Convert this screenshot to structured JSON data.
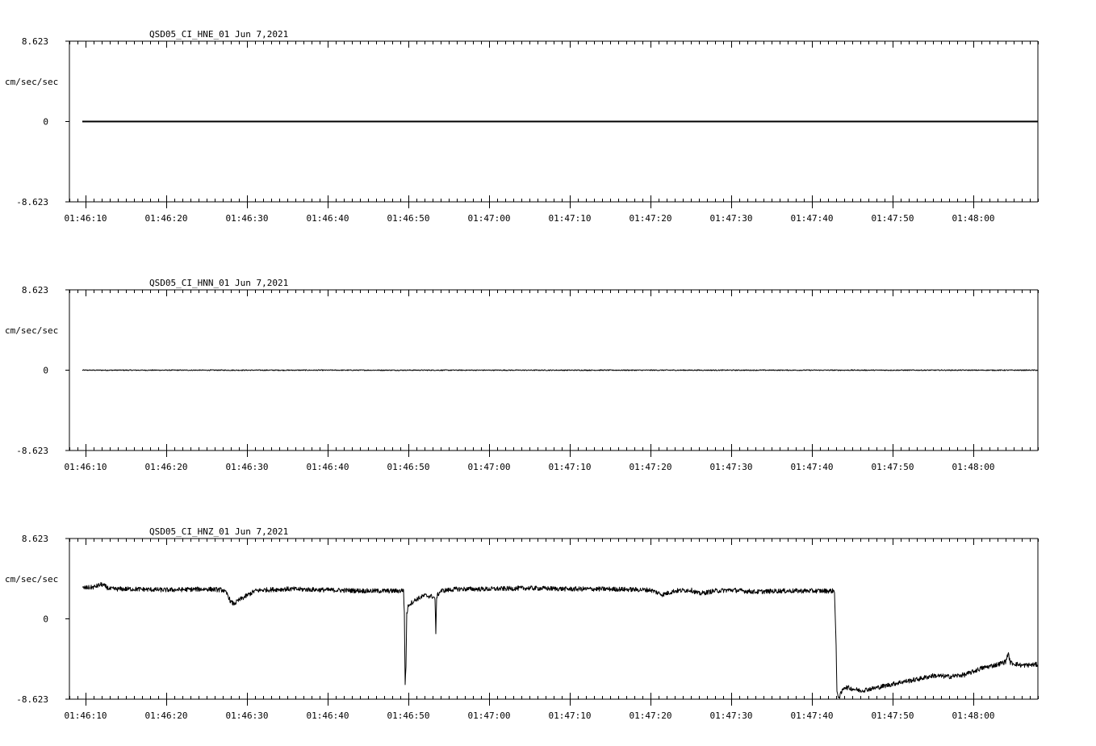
{
  "chart_data": [
    {
      "type": "line",
      "title": "QSD05_CI_HNE_01  Jun 7,2021",
      "ylabel": "cm/sec/sec",
      "ylim": [
        -8.623,
        8.623
      ],
      "y_ticks": [
        "8.623",
        "0",
        "-8.623"
      ],
      "x_ticks": [
        "01:46:10",
        "01:46:20",
        "01:46:30",
        "01:46:40",
        "01:46:50",
        "01:47:00",
        "01:47:10",
        "01:47:20",
        "01:47:30",
        "01:47:40",
        "01:47:50",
        "01:48:00"
      ],
      "x_range_seconds_after_014610": [
        -2.0,
        118.0
      ],
      "trace_start_seconds_after_014610": -0.4,
      "grid": false,
      "series": [
        {
          "values": [
            [
              -0.4,
              0
            ],
            [
              118.0,
              0
            ]
          ],
          "noise": 0
        }
      ]
    },
    {
      "type": "line",
      "title": "QSD05_CI_HNN_01  Jun 7,2021",
      "ylabel": "cm/sec/sec",
      "ylim": [
        -8.623,
        8.623
      ],
      "y_ticks": [
        "8.623",
        "0",
        "-8.623"
      ],
      "x_ticks": [
        "01:46:10",
        "01:46:20",
        "01:46:30",
        "01:46:40",
        "01:46:50",
        "01:47:00",
        "01:47:10",
        "01:47:20",
        "01:47:30",
        "01:47:40",
        "01:47:50",
        "01:48:00"
      ],
      "x_range_seconds_after_014610": [
        -2.0,
        118.0
      ],
      "trace_start_seconds_after_014610": -0.4,
      "grid": false,
      "series": [
        {
          "values": [
            [
              -0.4,
              0
            ],
            [
              118.0,
              0
            ]
          ],
          "noise": 0.05
        }
      ]
    },
    {
      "type": "line",
      "title": "QSD05_CI_HNZ_01  Jun 7,2021",
      "ylabel": "cm/sec/sec",
      "ylim": [
        -8.623,
        8.623
      ],
      "y_ticks": [
        "8.623",
        "0",
        "-8.623"
      ],
      "x_ticks": [
        "01:46:10",
        "01:46:20",
        "01:46:30",
        "01:46:40",
        "01:46:50",
        "01:47:00",
        "01:47:10",
        "01:47:20",
        "01:47:30",
        "01:47:40",
        "01:47:50",
        "01:48:00"
      ],
      "x_range_seconds_after_014610": [
        -2.0,
        118.0
      ],
      "trace_start_seconds_after_014610": -0.4,
      "grid": false,
      "series": [
        {
          "values": [
            [
              -0.4,
              3.3
            ],
            [
              1.0,
              3.4
            ],
            [
              2.0,
              3.7
            ],
            [
              3.0,
              3.2
            ],
            [
              6.0,
              3.2
            ],
            [
              10.0,
              3.1
            ],
            [
              15.0,
              3.2
            ],
            [
              17.0,
              3.1
            ],
            [
              17.6,
              2.6
            ],
            [
              18.0,
              1.8
            ],
            [
              18.4,
              1.6
            ],
            [
              19.0,
              2.0
            ],
            [
              20.0,
              2.5
            ],
            [
              21.0,
              3.0
            ],
            [
              22.0,
              3.1
            ],
            [
              25.0,
              3.2
            ],
            [
              30.0,
              3.1
            ],
            [
              35.0,
              3.0
            ],
            [
              39.0,
              3.0
            ],
            [
              39.4,
              3.1
            ],
            [
              39.5,
              0.5
            ],
            [
              39.6,
              -7.0
            ],
            [
              39.7,
              -5.0
            ],
            [
              39.8,
              0.5
            ],
            [
              40.0,
              1.5
            ],
            [
              41.0,
              2.1
            ],
            [
              42.0,
              2.5
            ],
            [
              43.0,
              2.4
            ],
            [
              43.3,
              2.2
            ],
            [
              43.4,
              -1.8
            ],
            [
              43.5,
              2.4
            ],
            [
              44.0,
              3.0
            ],
            [
              46.0,
              3.2
            ],
            [
              50.0,
              3.2
            ],
            [
              55.0,
              3.3
            ],
            [
              60.0,
              3.2
            ],
            [
              65.0,
              3.2
            ],
            [
              70.0,
              3.1
            ],
            [
              71.5,
              2.6
            ],
            [
              73.0,
              3.0
            ],
            [
              75.0,
              3.1
            ],
            [
              76.0,
              2.7
            ],
            [
              78.0,
              3.0
            ],
            [
              80.0,
              3.1
            ],
            [
              83.0,
              2.9
            ],
            [
              86.0,
              3.0
            ],
            [
              90.0,
              3.0
            ],
            [
              92.8,
              3.0
            ],
            [
              93.0,
              -3.0
            ],
            [
              93.1,
              -8.0
            ],
            [
              93.4,
              -8.4
            ],
            [
              94.0,
              -7.3
            ],
            [
              96.0,
              -7.7
            ],
            [
              98.0,
              -7.4
            ],
            [
              100.0,
              -7.0
            ],
            [
              101.0,
              -6.8
            ],
            [
              103.0,
              -6.5
            ],
            [
              105.0,
              -6.1
            ],
            [
              107.0,
              -6.2
            ],
            [
              109.0,
              -6.0
            ],
            [
              111.0,
              -5.3
            ],
            [
              113.0,
              -4.9
            ],
            [
              114.0,
              -4.6
            ],
            [
              114.3,
              -3.7
            ],
            [
              114.6,
              -4.7
            ],
            [
              116.0,
              -5.0
            ],
            [
              118.0,
              -4.9
            ]
          ],
          "noise": 0.25
        }
      ]
    }
  ]
}
